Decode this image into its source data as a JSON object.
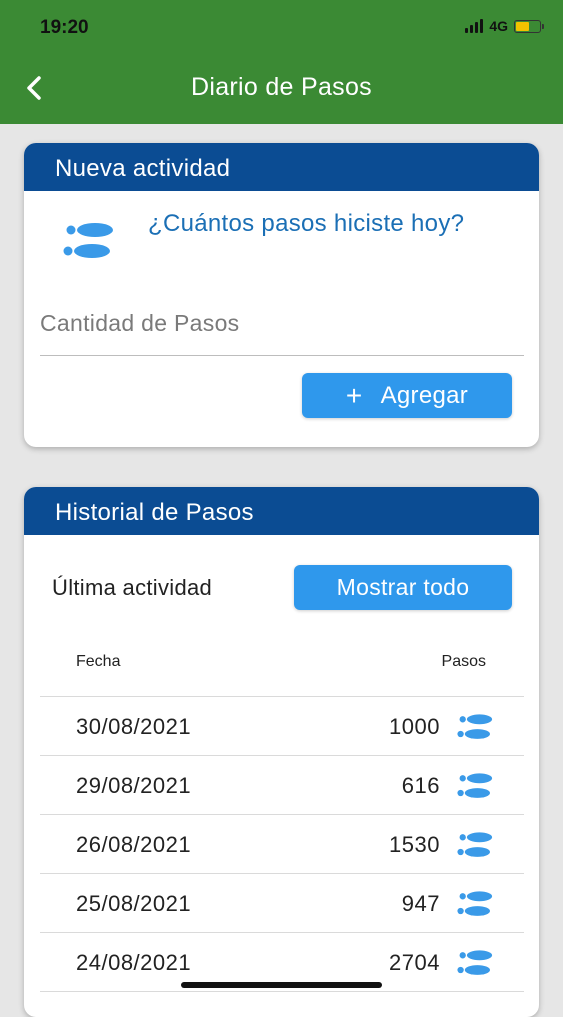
{
  "status_bar": {
    "time": "19:20",
    "network": "4G",
    "battery_color": "#f2c200"
  },
  "header": {
    "title": "Diario de Pasos",
    "back_icon": "chevron-left-icon",
    "background_color": "#3b8a34"
  },
  "new_activity": {
    "title": "Nueva actividad",
    "icon": "footsteps-icon",
    "prompt": "¿Cuántos pasos hiciste hoy?",
    "input": {
      "placeholder": "Cantidad de Pasos",
      "value": ""
    },
    "add_button": {
      "icon": "+",
      "label": "Agregar"
    }
  },
  "history": {
    "title": "Historial de Pasos",
    "last_activity_label": "Última actividad",
    "show_all_label": "Mostrar todo",
    "columns": {
      "date": "Fecha",
      "steps": "Pasos"
    },
    "rows": [
      {
        "date": "30/08/2021",
        "steps": "1000"
      },
      {
        "date": "29/08/2021",
        "steps": "616"
      },
      {
        "date": "26/08/2021",
        "steps": "1530"
      },
      {
        "date": "25/08/2021",
        "steps": "947"
      },
      {
        "date": "24/08/2021",
        "steps": "2704"
      }
    ],
    "row_icon": "footsteps-icon"
  },
  "colors": {
    "card_header": "#0b4c93",
    "accent_button": "#2f98ec",
    "prompt_text": "#1b6fb5",
    "footsteps_icon": "#3a9ae8"
  }
}
